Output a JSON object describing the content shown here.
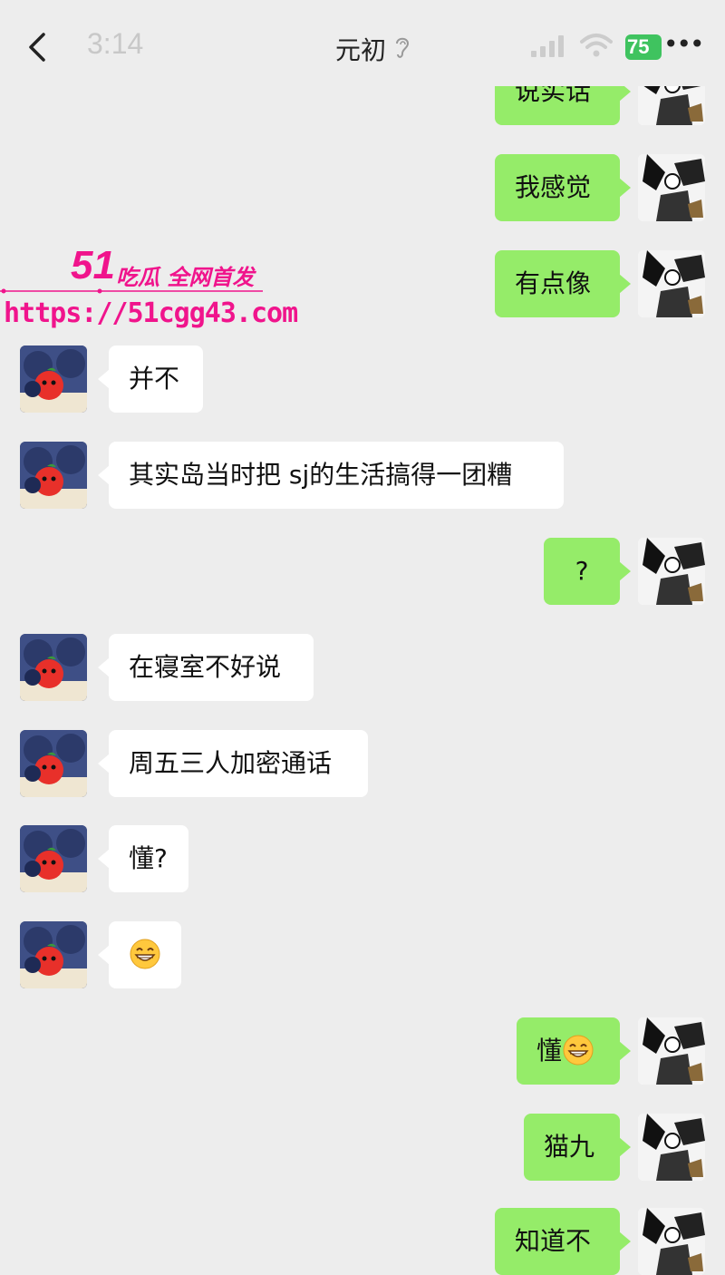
{
  "status_bar": {
    "time": "3:14",
    "battery": "75"
  },
  "header": {
    "title": "元初"
  },
  "watermark": {
    "logo": "51",
    "subtitle": "吃瓜 全网首发",
    "url": "https://51cgg43.com"
  },
  "messages": [
    {
      "side": "out",
      "text": "说实话"
    },
    {
      "side": "out",
      "text": "我感觉"
    },
    {
      "side": "out",
      "text": "有点像"
    },
    {
      "side": "in",
      "text": "并不"
    },
    {
      "side": "in",
      "text": "其实岛当时把 sj的生活搞得一团糟"
    },
    {
      "side": "out",
      "text": "?"
    },
    {
      "side": "in",
      "text": "在寝室不好说"
    },
    {
      "side": "in",
      "text": "周五三人加密通话"
    },
    {
      "side": "in",
      "text": "懂?"
    },
    {
      "side": "in",
      "text": "",
      "emoji": "grin-emoji"
    },
    {
      "side": "out",
      "text": "懂",
      "emoji": "grin-emoji"
    },
    {
      "side": "out",
      "text": "猫九"
    },
    {
      "side": "out",
      "text": "知道不"
    }
  ],
  "colors": {
    "background": "#ededed",
    "outgoing_bubble": "#95ec69",
    "incoming_bubble": "#ffffff",
    "watermark": "#f0148c",
    "battery": "#3fc35f"
  }
}
